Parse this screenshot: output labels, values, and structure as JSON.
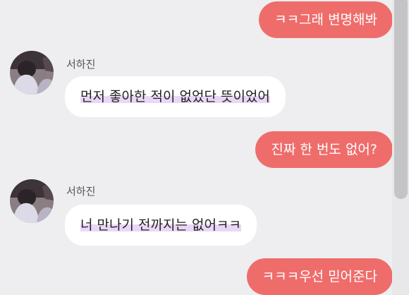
{
  "messages": [
    {
      "direction": "sent",
      "text": "ㅋㅋ그래 변명해봐"
    },
    {
      "direction": "received",
      "sender": "서하진",
      "text": "먼저 좋아한 적이 없었단 뜻이었어"
    },
    {
      "direction": "sent",
      "text": "진짜 한 번도 없어?"
    },
    {
      "direction": "received",
      "sender": "서하진",
      "text": "너 만나기 전까지는 없어ㅋㅋ"
    },
    {
      "direction": "sent",
      "text": "ㅋㅋㅋ우선 믿어준다"
    }
  ],
  "colors": {
    "background": "#eeeef0",
    "sent_bubble": "#ee6d6b",
    "received_bubble": "#ffffff",
    "highlight": "#ead7f6",
    "scroll_thumb": "#c4c4c6"
  }
}
